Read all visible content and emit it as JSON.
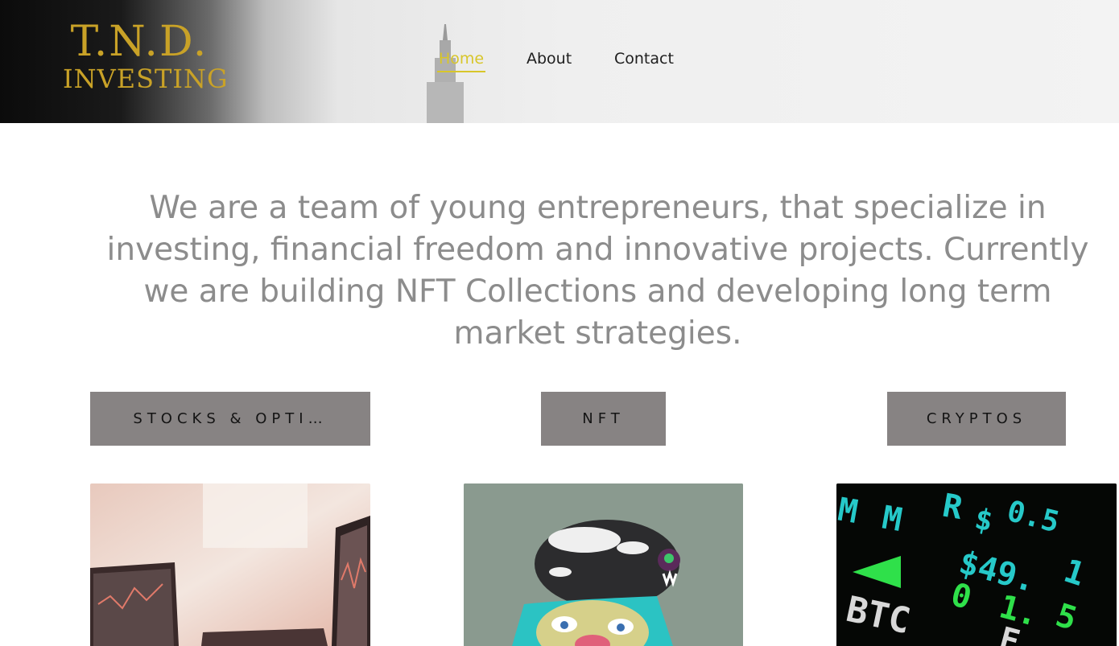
{
  "brand": {
    "line1": "T.N.D.",
    "line2": "INVESTING",
    "color": "#c9a227"
  },
  "nav": {
    "items": [
      {
        "label": "Home",
        "active": true
      },
      {
        "label": "About",
        "active": false
      },
      {
        "label": "Contact",
        "active": false
      }
    ],
    "active_color": "#d8c62a"
  },
  "intro": {
    "text": "We are a team of young entrepreneurs, that specialize in investing, financial freedom and innovative projects. Currently we are building NFT Collections and developing long term market strategies."
  },
  "categories": [
    {
      "label": "STOCKS & OPTI…"
    },
    {
      "label": "NFT"
    },
    {
      "label": "CRYPTOS"
    }
  ],
  "tiles": [
    {
      "icon": "laptop-charts-image"
    },
    {
      "icon": "nft-monkey-pirate-image"
    },
    {
      "icon": "crypto-ticker-board-image"
    }
  ],
  "colors": {
    "button_bg": "#878383",
    "intro_text": "#8c8c8c"
  }
}
